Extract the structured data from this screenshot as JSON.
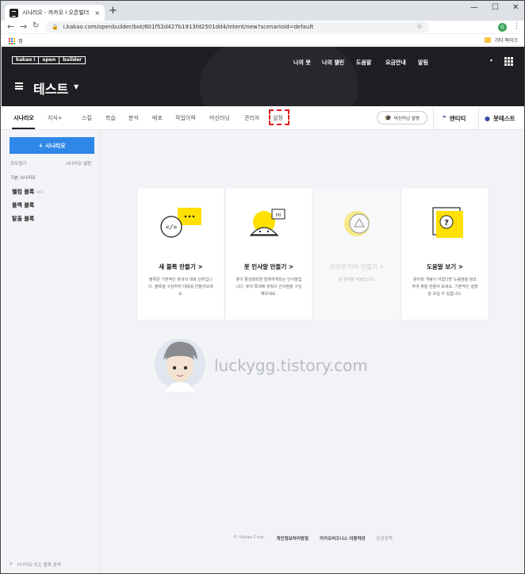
{
  "browser": {
    "tab_title": "시나리오 - 카카오 i 오픈빌더",
    "tab_close": "×",
    "new_tab": "+",
    "minimize": "—",
    "maximize": "☐",
    "close": "✕",
    "url": "i.kakao.com/openbuilder/bot/601f52d427b1913fd2501dd4/intent/new?scenarioId=default",
    "profile_initial": "G",
    "bookmark_apps_label": "앱",
    "bookmark_other": "기타 북마크"
  },
  "header": {
    "logo": [
      "kakao i",
      "open",
      "builder"
    ],
    "nav": [
      "나의 봇",
      "나의 챌린",
      "도움말",
      "요금안내",
      "알림"
    ],
    "bot_title": "테스트"
  },
  "subnav": {
    "tabs": [
      "시나리오",
      "지식+",
      "스킬",
      "학습",
      "분석",
      "배포",
      "작업이력",
      "머신러닝",
      "관리자",
      "설정"
    ],
    "active_tab": "시나리오",
    "highlighted_tab": "설정",
    "ml_button": "머신러닝 설명",
    "entity": "엔티티",
    "bot_test": "봇테스트"
  },
  "sidebar": {
    "add_button": "+ 시나리오",
    "collapse_all": "모두접기",
    "scenario_settings": "시나리오 설정",
    "group": "기본 시나리오",
    "items": [
      {
        "label": "웰컴 블록",
        "badge": "OFF"
      },
      {
        "label": "폴백 블록",
        "badge": ""
      },
      {
        "label": "탈출 블록",
        "badge": ""
      }
    ],
    "search_placeholder": "시나리오 또는 블록 검색"
  },
  "cards": [
    {
      "title": "새 블록 만들기 >",
      "desc": "블록은 기본적인 봇과의 대화 단위입니다. 블록을 구성하여 대화를 만들어보세요.",
      "enabled": true
    },
    {
      "title": "봇 인사말 만들기 >",
      "desc": "봇이 활성화되면 발화하게되는 인사말입니다. 봇의 특색에 맞춰서 인사말을 구성해보세요.",
      "enabled": true
    },
    {
      "title": "프리셋 따라 만들기 >",
      "desc": "곧 준비될 예정입니다.",
      "enabled": false
    },
    {
      "title": "도움말 보기 >",
      "desc": "용어와 개념이 어렵다면 도움말을 참조하여 봇을 만들어 보세요. 기본적인 설명을 보실 수 있습니다.",
      "enabled": true
    }
  ],
  "watermark": "luckygg.tistory.com",
  "footer": {
    "copyright": "© Kakao Corp.",
    "privacy": "개인정보처리방침",
    "terms": "카카오비즈니스 이용약관",
    "policy": "운영정책"
  },
  "colors": {
    "primary": "#2f87e8",
    "header_bg": "#1f1f23",
    "accent_yellow": "#ffe000",
    "highlight": "#e02020"
  }
}
